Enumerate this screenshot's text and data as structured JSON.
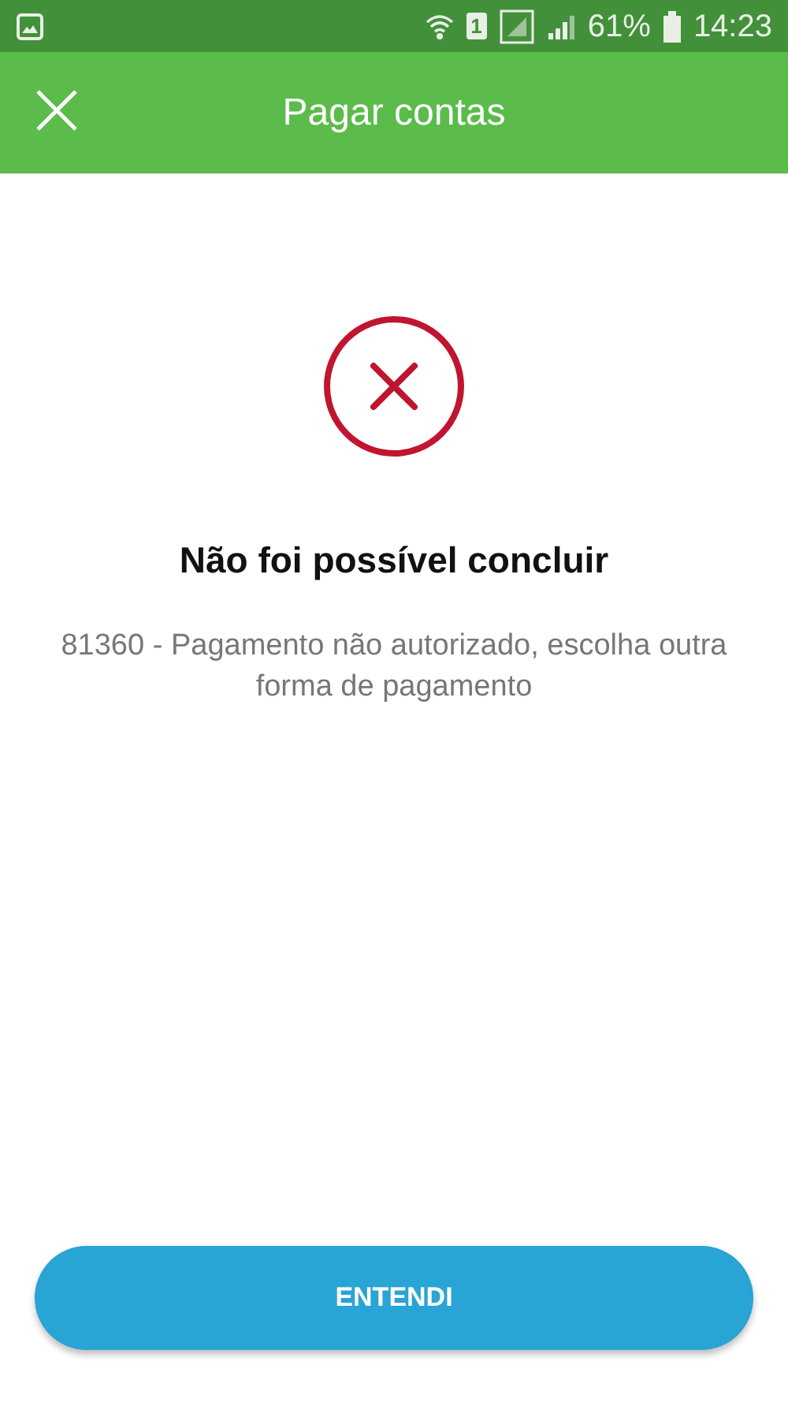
{
  "status_bar": {
    "sim_slot": "1",
    "battery": "61%",
    "time": "14:23"
  },
  "app_bar": {
    "title": "Pagar contas"
  },
  "result": {
    "kind": "error",
    "title": "Não foi possível concluir",
    "message": "81360 - Pagamento não autorizado, escolha outra forma de pagamento"
  },
  "button": {
    "label": "ENTENDI"
  }
}
